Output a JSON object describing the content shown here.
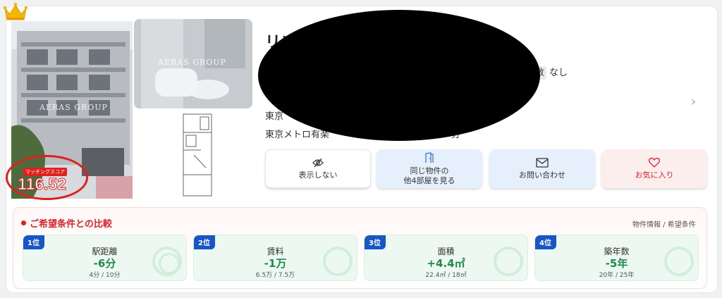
{
  "property": {
    "title": "リン",
    "tag_label": "数",
    "tag_value": "なし",
    "access_1": "東京",
    "access_2": "東京メトロ有楽",
    "access_3": "分",
    "watermark_1": "AERAS GROUP",
    "watermark_2": "AERAS GROUP"
  },
  "score": {
    "label": "マッチングスコア",
    "value": "116.52"
  },
  "actions": [
    {
      "label": "表示しない",
      "icon": "eye-off-icon"
    },
    {
      "label_1": "同じ物件の",
      "label_2": "他4部屋を見る",
      "icon": "door-icon"
    },
    {
      "label": "お問い合わせ",
      "icon": "mail-icon"
    },
    {
      "label": "お気に入り",
      "icon": "heart-icon"
    }
  ],
  "comparison": {
    "title": "ご希望条件との比較",
    "right_link": "物件情報 / 希望条件",
    "items": [
      {
        "rank": "1位",
        "label": "駅距離",
        "diff": "-6分",
        "sub": "4分 / 10分"
      },
      {
        "rank": "2位",
        "label": "賃料",
        "diff": "-1万",
        "sub": "6.5万 / 7.5万"
      },
      {
        "rank": "3位",
        "label": "面積",
        "diff": "+4.4㎡",
        "sub": "22.4㎡ / 18㎡"
      },
      {
        "rank": "4位",
        "label": "築年数",
        "diff": "-5年",
        "sub": "20年 / 25年"
      }
    ]
  },
  "colors": {
    "accent_red": "#d8262b",
    "rank_blue": "#1856c8",
    "diff_green": "#1f8a4a",
    "crown_gold": "#f2b705"
  }
}
